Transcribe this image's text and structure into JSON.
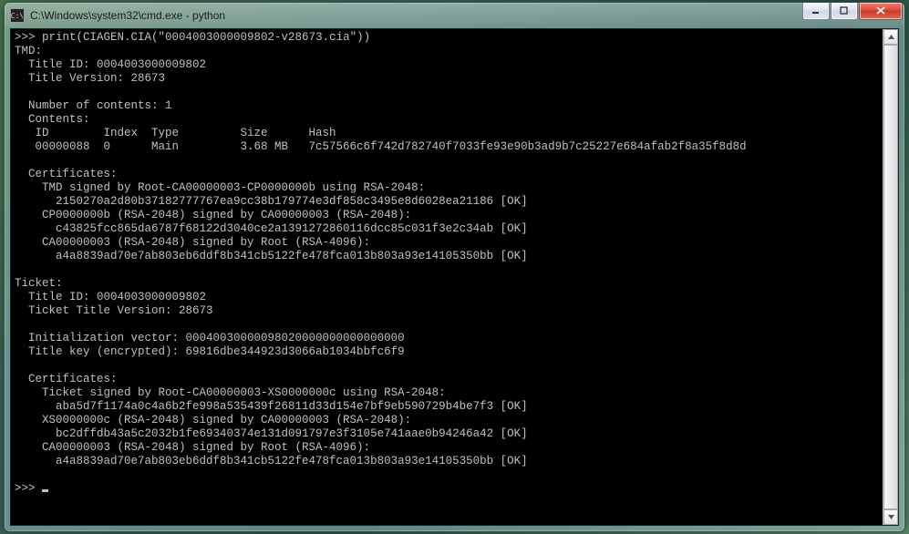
{
  "window": {
    "icon_text": "C:\\",
    "title": "C:\\Windows\\system32\\cmd.exe - python"
  },
  "prompt": ">>> ",
  "command": "print(CIAGEN.CIA(\"0004003000009802-v28673.cia\"))",
  "tmd": {
    "header": "TMD:",
    "title_id_label": "  Title ID: ",
    "title_id": "0004003000009802",
    "title_version_label": "  Title Version: ",
    "title_version": "28673",
    "num_contents_label": "  Number of contents: ",
    "num_contents": "1",
    "contents_label": "  Contents:",
    "contents_header": "   ID        Index  Type         Size      Hash",
    "contents_row": "   00000088  0      Main         3.68 MB   7c57566c6f742d782740f7033fe93e90b3ad9b7c25227e684afab2f8a35f8d8d",
    "certs_label": "  Certificates:",
    "cert1a": "    TMD signed by Root-CA00000003-CP0000000b using RSA-2048:",
    "cert1b": "      2150270a2d80b37182777767ea9cc38b179774e3df858c3495e8d6028ea21186 [OK]",
    "cert2a": "    CP0000000b (RSA-2048) signed by CA00000003 (RSA-2048):",
    "cert2b": "      c43825fcc865da6787f68122d3040ce2a1391272860116dcc85c031f3e2c34ab [OK]",
    "cert3a": "    CA00000003 (RSA-2048) signed by Root (RSA-4096):",
    "cert3b": "      a4a8839ad70e7ab803eb6ddf8b341cb5122fe478fca013b803a93e14105350bb [OK]"
  },
  "ticket": {
    "header": "Ticket:",
    "title_id_label": "  Title ID: ",
    "title_id": "0004003000009802",
    "version_label": "  Ticket Title Version: ",
    "version": "28673",
    "iv_label": "  Initialization vector: ",
    "iv": "00040030000098020000000000000000",
    "key_label": "  Title key (encrypted): ",
    "key": "69816dbe344923d3066ab1034bbfc6f9",
    "certs_label": "  Certificates:",
    "cert1a": "    Ticket signed by Root-CA00000003-XS0000000c using RSA-2048:",
    "cert1b": "      aba5d7f1174a0c4a6b2fe998a535439f26811d33d154e7bf9eb590729b4be7f3 [OK]",
    "cert2a": "    XS0000000c (RSA-2048) signed by CA00000003 (RSA-2048):",
    "cert2b": "      bc2dffdb43a5c2032b1fe69340374e131d091797e3f3105e741aae0b94246a42 [OK]",
    "cert3a": "    CA00000003 (RSA-2048) signed by Root (RSA-4096):",
    "cert3b": "      a4a8839ad70e7ab803eb6ddf8b341cb5122fe478fca013b803a93e14105350bb [OK]"
  },
  "final_prompt": ">>> "
}
